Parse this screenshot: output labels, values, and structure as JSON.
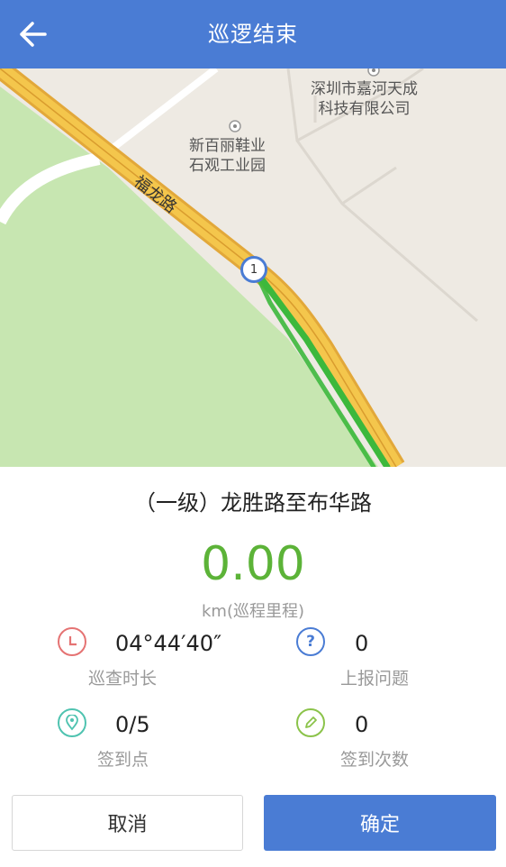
{
  "header": {
    "title": "巡逻结束",
    "back_icon": "back-arrow-icon"
  },
  "map": {
    "poi_1": "深圳市嘉河天成\n科技有限公司",
    "poi_2": "新百丽鞋业\n石观工业园",
    "road_name": "福龙路",
    "start_marker": "1"
  },
  "route": {
    "name": "（一级）龙胜路至布华路"
  },
  "distance": {
    "value": "0.00",
    "unit_label": "km(巡程里程)"
  },
  "stats": {
    "duration": {
      "value": "04°44′40″",
      "label": "巡查时长",
      "icon": "clock-icon"
    },
    "reported_issues": {
      "value": "0",
      "label": "上报问题",
      "icon": "question-icon"
    },
    "checkin_points": {
      "value": "0/5",
      "label": "签到点",
      "icon": "location-pin-icon"
    },
    "checkin_count": {
      "value": "0",
      "label": "签到次数",
      "icon": "pencil-icon"
    }
  },
  "buttons": {
    "cancel": "取消",
    "confirm": "确定"
  },
  "colors": {
    "header": "#4a7cd4",
    "distance": "#5cb338",
    "clock_icon": "#e57373",
    "question_icon": "#4a7cd4",
    "location_icon": "#4fc3b0",
    "pencil_icon": "#8bc34a"
  }
}
